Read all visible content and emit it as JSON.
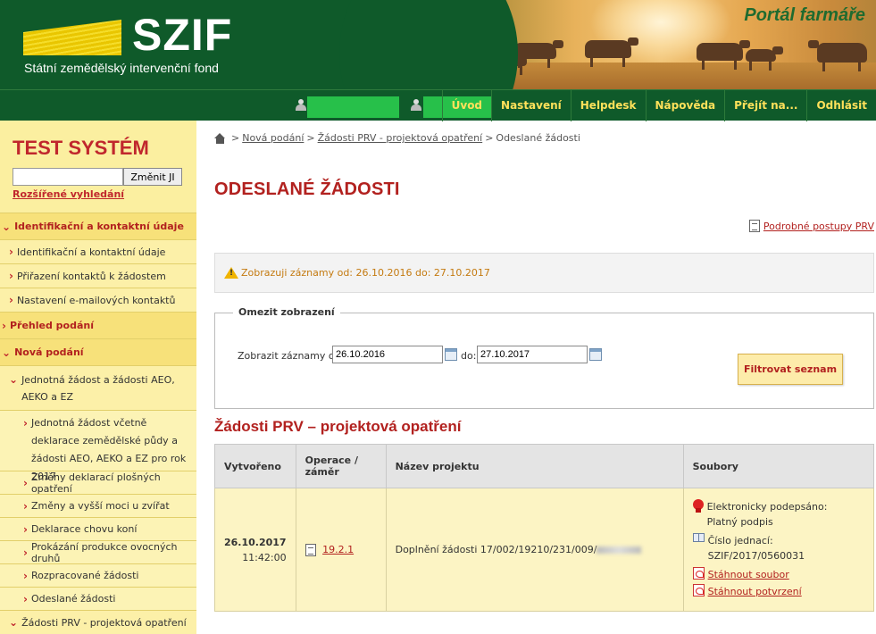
{
  "header": {
    "logo_text": "SZIF",
    "logo_subtitle": "Státní zemědělský intervenční fond",
    "portal_title": "Portál farmáře"
  },
  "nav": {
    "items": [
      "Úvod",
      "Nastavení",
      "Helpdesk",
      "Nápověda",
      "Přejít na...",
      "Odhlásit"
    ]
  },
  "sidebar": {
    "system_title": "TEST SYSTÉM",
    "ji_input_value": "",
    "ji_button": "Změnit JI",
    "advanced_search": "Rozšířené vyhledání",
    "menu": [
      {
        "label": "Identifikační a kontaktní údaje",
        "level": "top"
      },
      {
        "label": "Identifikační a kontaktní údaje",
        "level": "l1"
      },
      {
        "label": "Přiřazení kontaktů k žádostem",
        "level": "l1"
      },
      {
        "label": "Nastavení e-mailových kontaktů",
        "level": "l1"
      },
      {
        "label": "Přehled podání",
        "level": "top"
      },
      {
        "label": "Nová podání",
        "level": "top"
      },
      {
        "label": "Jednotná žádost a žádosti AEO, AEKO a EZ",
        "level": "l1m"
      },
      {
        "label": "Jednotná žádost včetně deklarace zemědělské půdy a žádosti AEO, AEKO a EZ pro rok 2017",
        "level": "l2m"
      },
      {
        "label": "Změny deklarací plošných opatření",
        "level": "l2"
      },
      {
        "label": "Změny a vyšší moci u zvířat",
        "level": "l2"
      },
      {
        "label": "Deklarace chovu koní",
        "level": "l2"
      },
      {
        "label": "Prokázání produkce ovocných druhů",
        "level": "l2"
      },
      {
        "label": "Rozpracované žádosti",
        "level": "l2"
      },
      {
        "label": "Odeslané žádosti",
        "level": "l2"
      },
      {
        "label": "Žádosti PRV - projektová opatření",
        "level": "l1"
      }
    ]
  },
  "breadcrumb": {
    "items": [
      "Nová podání",
      "Žádosti PRV - projektová opatření"
    ],
    "current": "Odeslané žádosti",
    "separator": ">"
  },
  "page": {
    "title": "ODESLANÉ ŽÁDOSTI",
    "postupy_link": "Podrobné postupy PRV",
    "info_text": "Zobrazuji záznamy od: 26.10.2016 do: 27.10.2017"
  },
  "filter": {
    "legend": "Omezit zobrazení",
    "from_label": "Zobrazit záznamy od:",
    "from_value": "26.10.2016",
    "to_label": "do:",
    "to_value": "27.10.2017",
    "button": "Filtrovat seznam"
  },
  "table": {
    "section_title": "Žádosti PRV – projektová opatření",
    "headers": {
      "created": "Vytvořeno",
      "operation": "Operace / záměr",
      "project": "Název projektu",
      "files": "Soubory"
    },
    "rows": [
      {
        "date": "26.10.2017",
        "time": "11:42:00",
        "operation": "19.2.1",
        "project": "Doplnění žádosti 17/002/19210/231/009/",
        "files": {
          "signed_label": "Elektronicky podepsáno:",
          "signed_value": "Platný podpis",
          "ref_label": "Číslo jednací:",
          "ref_value": "SZIF/2017/0560031",
          "download_file": "Stáhnout soubor",
          "download_confirm": "Stáhnout potvrzení"
        }
      }
    ]
  },
  "colors": {
    "dark_green": "#0f5a2a",
    "accent_red": "#b2211f",
    "nav_yellow": "#ffe15a",
    "sidebar_bg": "#fbefa0",
    "row_bg": "#fcf4c4"
  }
}
